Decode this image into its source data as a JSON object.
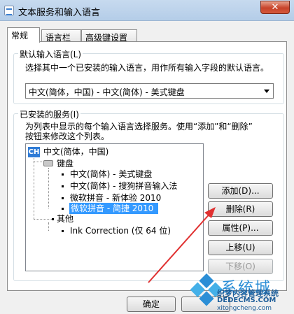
{
  "window": {
    "title": "文本服务和输入语言",
    "close_label": "✕"
  },
  "tabs": [
    {
      "label": "常规",
      "active": true
    },
    {
      "label": "语言栏",
      "active": false
    },
    {
      "label": "高级键设置",
      "active": false
    }
  ],
  "default_language": {
    "group_label": "默认输入语言(L)",
    "description": "选择其中一个已安装的输入语言，用作所有输入字段的默认语言。",
    "selected_value": "中文(简体，中国) - 中文(简体) - 美式键盘"
  },
  "installed_services": {
    "group_label": "已安装的服务(I)",
    "description_line1": "为列表中显示的每个输入语言选择服务。使用“添加”和“删除”",
    "description_line2": "按钮来修改这个列表。",
    "tree": {
      "language_badge": "CH",
      "language": "中文(简体，中国)",
      "keyboard_group": "键盘",
      "keyboards": [
        "中文(简体) - 美式键盘",
        "中文(简体) - 搜狗拼音输入法",
        "微软拼音 - 新体验 2010",
        "微软拼音 - 简捷 2010"
      ],
      "selected_index": 3,
      "other_group": "其他",
      "others": [
        "Ink Correction (仅 64 位)"
      ]
    },
    "buttons": {
      "add": "添加(D)...",
      "delete": "删除(R)",
      "properties": "属性(P)...",
      "move_up": "上移(U)",
      "move_down": "下移(O)"
    }
  },
  "footer": {
    "ok": "确定",
    "cancel": ""
  },
  "watermark": {
    "main": "系统城",
    "sub1": "织梦内容管理系统",
    "sub2": "DEDECMS.COM",
    "sub3": "xitongcheng.com"
  },
  "colors": {
    "selection": "#3399ff",
    "annotation_arrow": "#e03030",
    "language_badge": "#2f7bd6"
  }
}
